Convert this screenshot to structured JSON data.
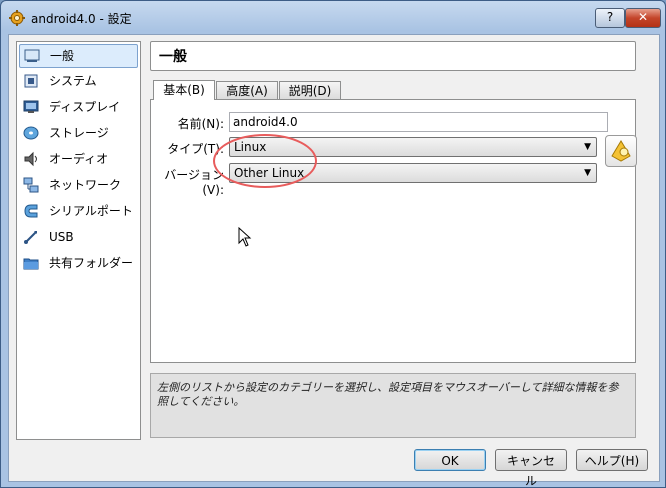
{
  "window": {
    "title": "android4.0 - 設定",
    "help_label": "?",
    "close_label": "✕"
  },
  "sidebar": {
    "items": [
      {
        "label": "一般",
        "icon": "general-icon",
        "selected": true
      },
      {
        "label": "システム",
        "icon": "system-chip-icon"
      },
      {
        "label": "ディスプレイ",
        "icon": "display-monitor-icon"
      },
      {
        "label": "ストレージ",
        "icon": "storage-disk-icon"
      },
      {
        "label": "オーディオ",
        "icon": "speaker-icon"
      },
      {
        "label": "ネットワーク",
        "icon": "network-icon"
      },
      {
        "label": "シリアルポート",
        "icon": "serial-port-icon"
      },
      {
        "label": "USB",
        "icon": "usb-icon"
      },
      {
        "label": "共有フォルダー",
        "icon": "folder-icon"
      }
    ]
  },
  "page": {
    "title": "一般"
  },
  "tabs": [
    {
      "label": "基本(B)",
      "active": true
    },
    {
      "label": "高度(A)"
    },
    {
      "label": "説明(D)"
    }
  ],
  "form": {
    "name_label": "名前(N):",
    "name_value": "android4.0",
    "type_label": "タイプ(T):",
    "type_value": "Linux",
    "version_label": "バージョン(V):",
    "version_value": "Other Linux"
  },
  "info_text": "左側のリストから設定のカテゴリーを選択し、設定項目をマウスオーバーして詳細な情報を参照してください。",
  "buttons": {
    "ok": "OK",
    "cancel": "キャンセル",
    "help": "ヘルプ(H)"
  },
  "colors": {
    "highlight": "#e85c5c",
    "selection": "#dcecfc"
  }
}
